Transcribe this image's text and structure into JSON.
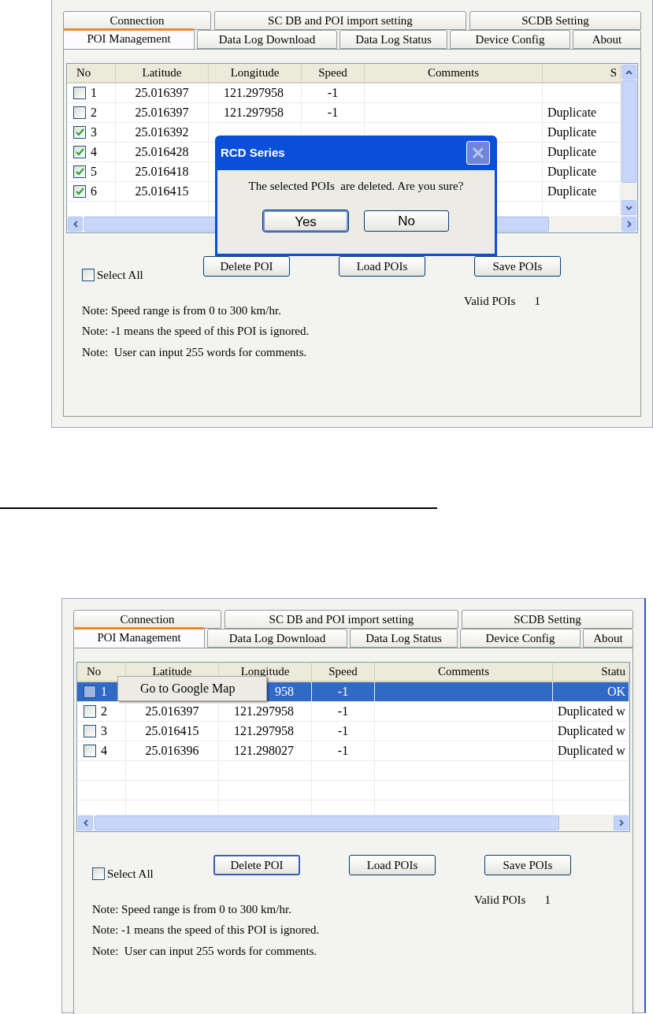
{
  "screenshots": [
    {
      "tabs_row_1": [
        {
          "label": "Connection",
          "selected": false
        },
        {
          "label": "SC DB and POI import setting",
          "selected": false
        },
        {
          "label": "SCDB  Setting",
          "selected": false
        }
      ],
      "tabs_row_2": [
        {
          "label": "POI Management",
          "selected": true
        },
        {
          "label": "Data Log Download",
          "selected": false
        },
        {
          "label": "Data Log Status",
          "selected": false
        },
        {
          "label": "Device Config",
          "selected": false
        },
        {
          "label": "About",
          "selected": false
        }
      ],
      "table": {
        "columns": [
          "No",
          "Latitude",
          "Longitude",
          "Speed",
          "Comments",
          "S"
        ],
        "vertical_scrollbar": true,
        "rows": [
          {
            "checked": false,
            "selected": false,
            "no": "1",
            "latitude": "25.016397",
            "longitude": "121.297958",
            "speed": "-1"
          },
          {
            "checked": false,
            "selected": false,
            "no": "2",
            "latitude": "25.016397",
            "longitude": "121.297958",
            "speed": "-1",
            "status": "Duplicate"
          },
          {
            "checked": true,
            "selected": false,
            "no": "3",
            "latitude": "25.016392",
            "status": "Duplicate"
          },
          {
            "checked": true,
            "selected": false,
            "no": "4",
            "latitude": "25.016428",
            "status": "Duplicate"
          },
          {
            "checked": true,
            "selected": false,
            "no": "5",
            "latitude": "25.016418",
            "status": "Duplicate"
          },
          {
            "checked": true,
            "selected": false,
            "no": "6",
            "latitude": "25.016415",
            "status": "Duplicate"
          }
        ]
      },
      "select_all": {
        "label": "Select All",
        "checked": false
      },
      "buttons": [
        {
          "label": "Delete POI",
          "focused": false
        },
        {
          "label": "Load POIs",
          "focused": false
        },
        {
          "label": "Save POIs",
          "focused": false
        }
      ],
      "valid_pois": {
        "label": "Valid POIs",
        "value": "1"
      },
      "notes": [
        "Note: Speed range is from 0 to 300 km/hr.",
        "Note: -1 means the speed of this POI is ignored.",
        "Note:  User can input 255 words for comments."
      ],
      "dialog": {
        "title": "RCD Series",
        "message": "The selected POIs  are deleted. Are you sure?",
        "buttons": [
          {
            "label": "Yes",
            "focused": true
          },
          {
            "label": "No",
            "focused": false
          }
        ]
      }
    },
    {
      "tabs_row_1": [
        {
          "label": "Connection",
          "selected": false
        },
        {
          "label": "SC DB and POI import setting",
          "selected": false
        },
        {
          "label": "SCDB  Setting",
          "selected": false
        }
      ],
      "tabs_row_2": [
        {
          "label": "POI Management",
          "selected": true
        },
        {
          "label": "Data Log Download",
          "selected": false
        },
        {
          "label": "Data Log Status",
          "selected": false
        },
        {
          "label": "Device Config",
          "selected": false
        },
        {
          "label": "About",
          "selected": false
        }
      ],
      "table": {
        "columns": [
          "No",
          "Latitude",
          "Longitude",
          "Speed",
          "Comments",
          "Statu"
        ],
        "vertical_scrollbar": false,
        "rows": [
          {
            "checked": false,
            "selected": true,
            "no": "1",
            "longitude": "958",
            "speed": "-1",
            "status": "OK"
          },
          {
            "checked": false,
            "selected": false,
            "no": "2",
            "latitude": "25.016397",
            "longitude": "121.297958",
            "speed": "-1",
            "status": "Duplicated w"
          },
          {
            "checked": false,
            "selected": false,
            "no": "3",
            "latitude": "25.016415",
            "longitude": "121.297958",
            "speed": "-1",
            "status": "Duplicated w"
          },
          {
            "checked": false,
            "selected": false,
            "no": "4",
            "latitude": "25.016396",
            "longitude": "121.298027",
            "speed": "-1",
            "status": "Duplicated w"
          }
        ]
      },
      "select_all": {
        "label": "Select All",
        "checked": false
      },
      "buttons": [
        {
          "label": "Delete POI",
          "focused": true
        },
        {
          "label": "Load POIs",
          "focused": false
        },
        {
          "label": "Save POIs",
          "focused": false
        }
      ],
      "valid_pois": {
        "label": "Valid POIs",
        "value": "1"
      },
      "notes": [
        "Note: Speed range is from 0 to 300 km/hr.",
        "Note: -1 means the speed of this POI is ignored.",
        "Note:  User can input 255 words for comments."
      ],
      "context_menu": {
        "items": [
          "Go to Google Map"
        ]
      }
    }
  ]
}
